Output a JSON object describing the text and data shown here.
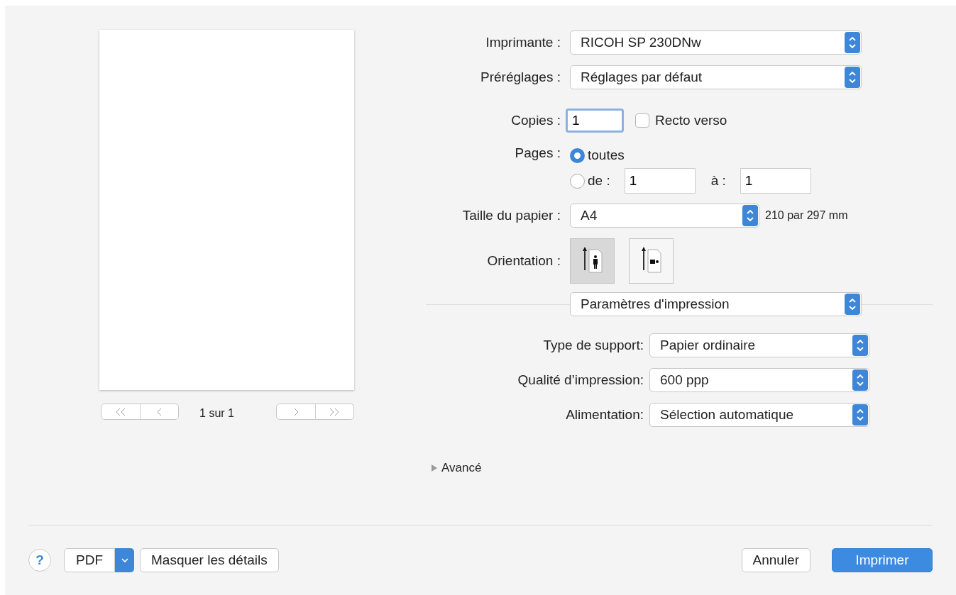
{
  "preview": {
    "page_indicator": "1 sur 1"
  },
  "printer": {
    "label": "Imprimante :",
    "value": "RICOH SP 230DNw"
  },
  "presets": {
    "label": "Préréglages :",
    "value": "Réglages par défaut"
  },
  "copies": {
    "label": "Copies :",
    "value": "1"
  },
  "duplex": {
    "label": "Recto verso",
    "checked": false
  },
  "pages": {
    "label": "Pages :",
    "options": [
      {
        "label": "toutes",
        "selected": true
      },
      {
        "label": "de :",
        "selected": false
      }
    ],
    "from": "1",
    "to_label": "à :",
    "to": "1"
  },
  "paper_size": {
    "label": "Taille du papier :",
    "value": "A4",
    "note": "210 par 297 mm"
  },
  "orientation": {
    "label": "Orientation :",
    "options": [
      {
        "kind": "portrait",
        "selected": true
      },
      {
        "kind": "landscape",
        "selected": false
      }
    ]
  },
  "section_menu": "Paramètres d'impression",
  "settings": [
    {
      "label": "Type de support:",
      "value": "Papier ordinaire"
    },
    {
      "label": "Qualité d’impression:",
      "value": "600 ppp"
    },
    {
      "label": "Alimentation:",
      "value": "Sélection automatique"
    }
  ],
  "advanced": {
    "label": "Avancé",
    "expanded": false
  },
  "footer": {
    "help": "?",
    "pdf": "PDF",
    "toggle_details": "Masquer les détails",
    "cancel": "Annuler",
    "print": "Imprimer"
  }
}
